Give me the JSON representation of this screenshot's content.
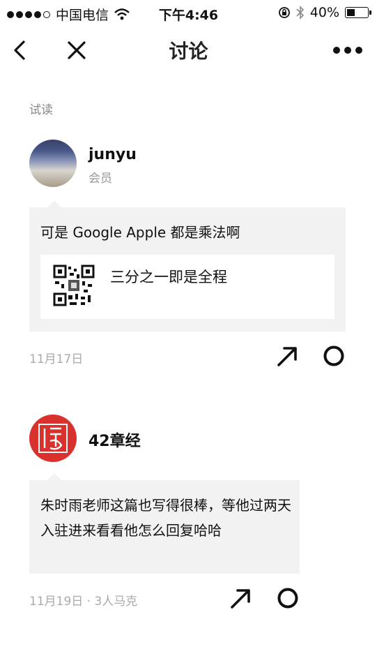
{
  "status_bar": {
    "carrier": "中国电信",
    "time": "下午4:46",
    "battery": "40%",
    "battery_level": 0.4
  },
  "nav": {
    "title": "讨论"
  },
  "section_label": "试读",
  "posts": [
    {
      "author": "junyu",
      "badge": "会员",
      "text": "可是 Google Apple 都是乘法啊",
      "card_title": "三分之一即是全程",
      "date": "11月17日"
    },
    {
      "author": "42章经",
      "text": "朱时雨老师这篇也写得很棒，等他过两天入驻进来看看他怎么回复哈哈",
      "date": "11月19日 · 3人马克"
    }
  ],
  "colors": {
    "bubble_bg": "#f2f2f2",
    "avatar2_red": "#d9312d",
    "meta_gray": "#aaaaaa"
  },
  "icons": [
    "back-icon",
    "close-icon",
    "more-icon",
    "wifi-icon",
    "lock-rotation-icon",
    "bluetooth-icon",
    "battery-icon",
    "share-arrow-icon",
    "circle-icon"
  ]
}
